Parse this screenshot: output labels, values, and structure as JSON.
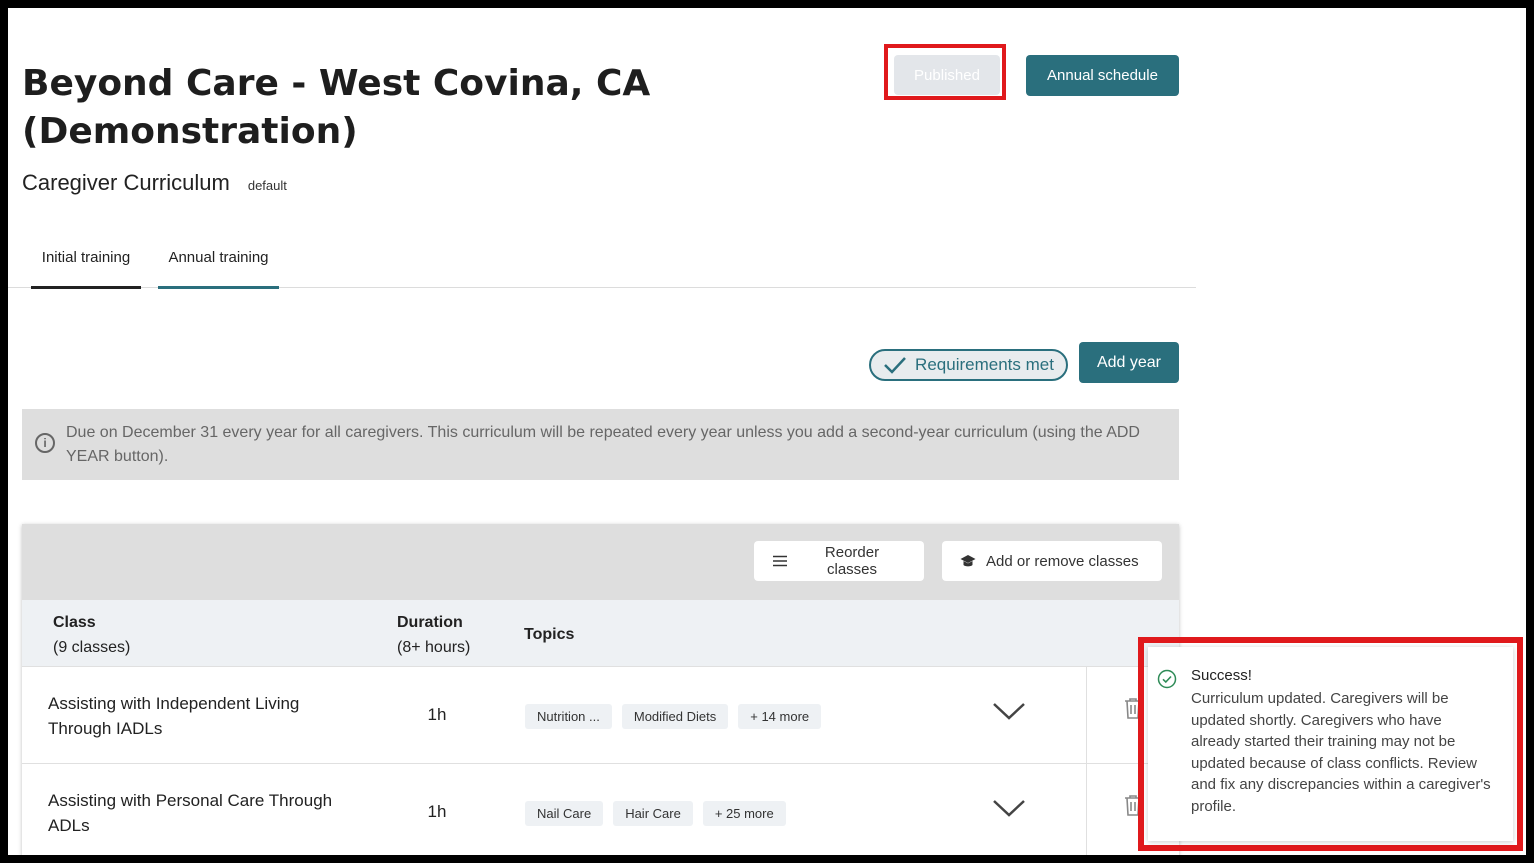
{
  "page": {
    "title": "Beyond Care - West Covina, CA (Demonstration)",
    "subtitle": "Caregiver Curriculum",
    "tag": "default"
  },
  "header_buttons": {
    "published": "Published",
    "annual_schedule": "Annual schedule"
  },
  "tabs": [
    {
      "label": "Initial training"
    },
    {
      "label": "Annual training"
    }
  ],
  "status": {
    "requirements": "Requirements met",
    "add_year": "Add year"
  },
  "info": {
    "icon": "info-icon",
    "text": "Due on December 31 every year for all caregivers. This curriculum will be repeated every year unless you add a second-year curriculum (using the ADD YEAR button)."
  },
  "toolbar": {
    "reorder": "Reorder classes",
    "add_remove": "Add or remove classes"
  },
  "table": {
    "class_header": "Class",
    "class_count": "(9 classes)",
    "duration_header": "Duration",
    "duration_total": "(8+ hours)",
    "topics_header": "Topics",
    "rows": [
      {
        "name": "Assisting with Independent Living Through IADLs",
        "duration": "1h",
        "topics": [
          "Nutrition ...",
          "Modified Diets",
          "+ 14 more"
        ]
      },
      {
        "name": "Assisting with Personal Care Through ADLs",
        "duration": "1h",
        "topics": [
          "Nail Care",
          "Hair Care",
          "+ 25 more"
        ]
      }
    ]
  },
  "toast": {
    "title": "Success!",
    "message": "Curriculum updated. Caregivers will be updated shortly. Caregivers who have already started their training may not be updated because of class conflicts. Review and fix any discrepancies within a caregiver's profile."
  },
  "colors": {
    "accent": "#2a6f7d",
    "highlight": "#e0191c",
    "success": "#2e8b57"
  }
}
